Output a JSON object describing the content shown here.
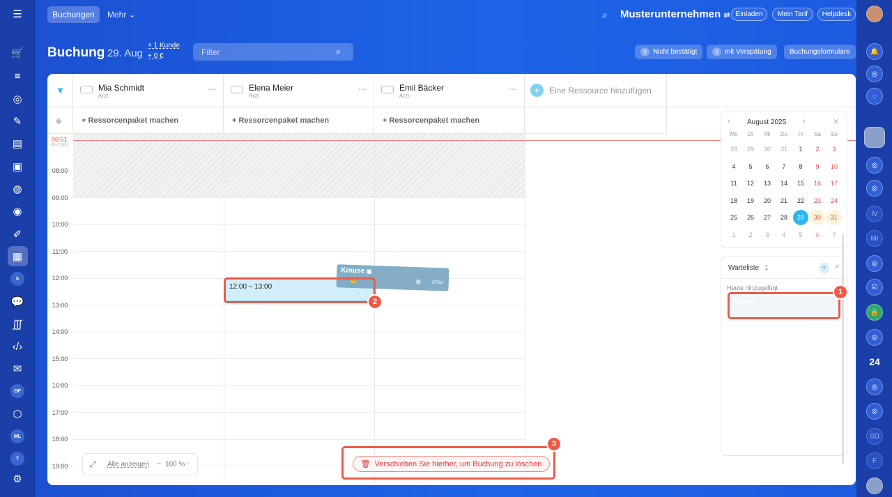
{
  "nav": {
    "active_tab": "Buchungen",
    "more_tab": "Mehr",
    "company": "Musterunternehmen",
    "invite": "Einladen",
    "my_plan": "Mein Tarif",
    "helpdesk": "Helpdesk"
  },
  "header": {
    "title": "Buchung",
    "date": "29. Aug",
    "clients": "+ 1 Kunde",
    "amount": "+ 0 €",
    "filter_placeholder": "Filter",
    "unconfirmed_count": "0",
    "unconfirmed": "Nicht bestätigt",
    "late_count": "0",
    "late": "mit Verspätung",
    "forms": "Buchungsformulare"
  },
  "resources": [
    {
      "name": "Mia Schmidt",
      "role": "Arzt"
    },
    {
      "name": "Elena Meier",
      "role": "Arzt"
    },
    {
      "name": "Emil Bäcker",
      "role": "Arzt"
    }
  ],
  "add_resource": "Eine Ressource hinzufügen",
  "package_label": "+ Ressorcenpaket machen",
  "now_label": "06:51",
  "times": [
    "07:00",
    "08:00",
    "09:00",
    "10:00",
    "11:00",
    "12:00",
    "13:00",
    "14:00",
    "15:00",
    "16:00",
    "17:00",
    "18:00",
    "19:00"
  ],
  "calendar": {
    "month": "August 2025",
    "weekdays": [
      "Mo",
      "Di",
      "Mi",
      "Do",
      "Fr",
      "Sa",
      "So"
    ],
    "rows": [
      [
        "28",
        "29",
        "30",
        "31",
        "1",
        "2",
        "3"
      ],
      [
        "4",
        "5",
        "6",
        "7",
        "8",
        "9",
        "10"
      ],
      [
        "11",
        "12",
        "13",
        "14",
        "15",
        "16",
        "17"
      ],
      [
        "18",
        "19",
        "20",
        "21",
        "22",
        "23",
        "24"
      ],
      [
        "25",
        "26",
        "27",
        "28",
        "29",
        "30",
        "31"
      ],
      [
        "1",
        "2",
        "3",
        "4",
        "5",
        "6",
        "7"
      ]
    ],
    "selected": "29"
  },
  "waitlist": {
    "title": "Warteliste",
    "count": "1",
    "section": "Heute hinzugefügt",
    "item_name": "Krause"
  },
  "booking": {
    "time": "12:00 – 13:00"
  },
  "drag": {
    "name": "Krause",
    "crm": "CRM"
  },
  "delete_zone": "Verschieben Sie hierher, um Buchung zu löschen",
  "zoom": {
    "show_all": "Alle anzeigen",
    "percent": "100 %"
  },
  "markers": [
    "1",
    "2",
    "3"
  ],
  "sidebar_left_badges": [
    "S",
    "DF",
    "ML",
    "T"
  ],
  "sidebar_right_badges": [
    "IV",
    "MI",
    "SD",
    "F",
    "24"
  ],
  "colors": {
    "accent": "#2fb5f0",
    "highlight": "#ee5a4a",
    "weekend": "#e04a4a"
  }
}
